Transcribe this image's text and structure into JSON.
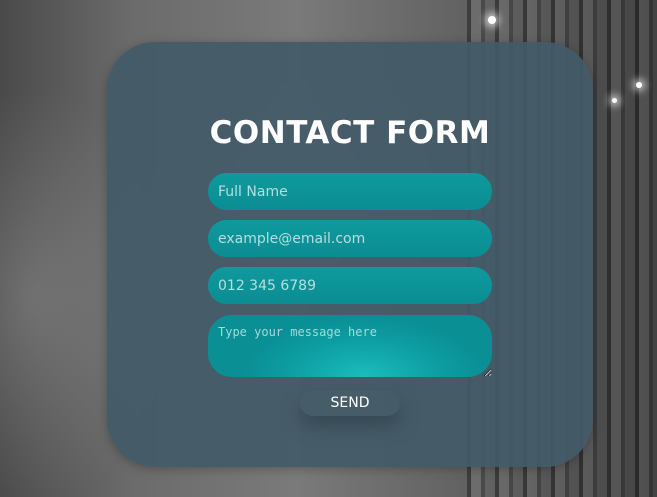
{
  "form": {
    "title": "CONTACT FORM",
    "name_placeholder": "Full Name",
    "email_placeholder": "example@email.com",
    "phone_placeholder": "012 345 6789",
    "message_placeholder": "Type your message here",
    "send_label": "SEND"
  },
  "colors": {
    "card_background": "#435a68",
    "field_background": "#0f9a9d",
    "text": "#ffffff"
  }
}
